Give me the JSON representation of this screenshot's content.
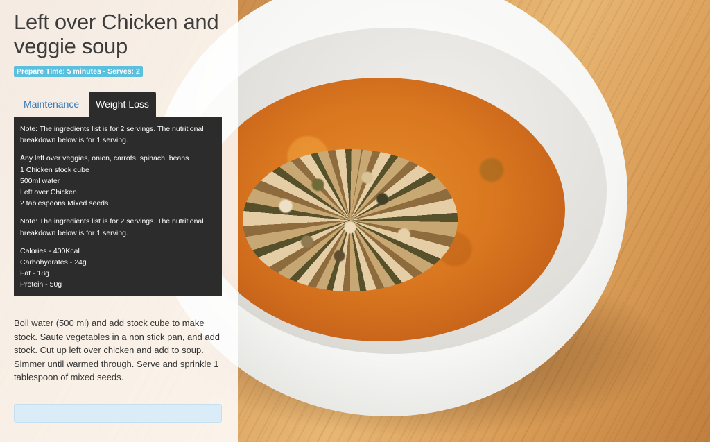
{
  "recipe": {
    "title": "Left over Chicken and veggie soup",
    "badge": "Prepare Time: 5 minutes - Serves: 2"
  },
  "tabs": [
    {
      "label": "Maintenance",
      "active": false
    },
    {
      "label": "Weight Loss",
      "active": true
    }
  ],
  "content": {
    "note_top": "Note: The ingredients list is for 2 servings. The nutritional breakdown below is for 1 serving.",
    "ingredients": [
      "Any left over veggies, onion, carrots, spinach, beans",
      "1 Chicken stock cube",
      "500ml water",
      "Left over Chicken",
      "2 tablespoons Mixed seeds"
    ],
    "note_bottom": "Note: The ingredients list is for 2 servings. The nutritional breakdown below is for 1 serving.",
    "nutrition": [
      "Calories - 400Kcal",
      "Carbohydrates - 24g",
      "Fat - 18g",
      "Protein - 50g"
    ]
  },
  "instructions": "Boil water (500 ml) and add stock cube to make stock. Saute vegetables in a non stick pan, and add stock. Cut up left over chicken and add to soup. Simmer until warmed through. Serve and sprinkle 1 tablespoon of mixed seeds.",
  "colors": {
    "badge": "#5bc0de",
    "active_tab": "#2c2c2c",
    "link": "#337ab7",
    "action_bar": "#d9ecf7"
  }
}
